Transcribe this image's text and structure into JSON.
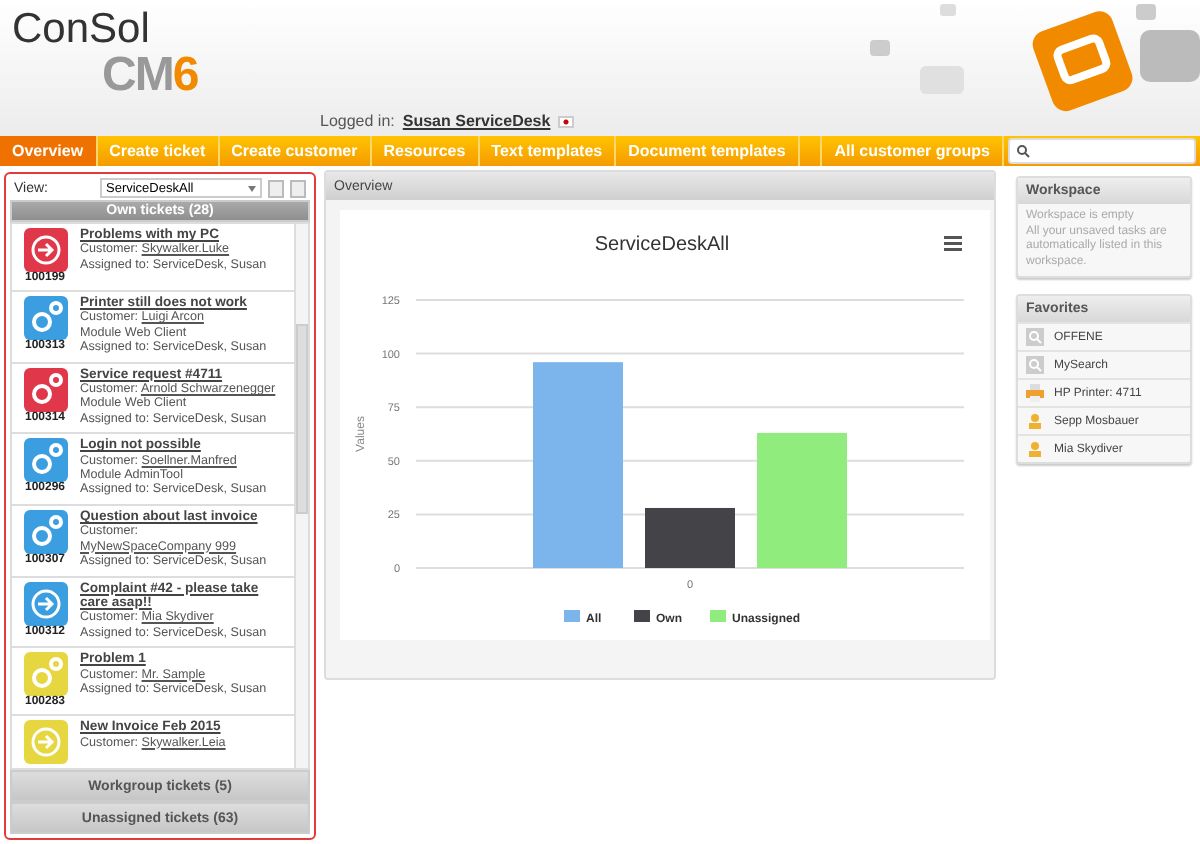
{
  "logo": {
    "line1": "ConSol",
    "line2": "CM",
    "version": "6"
  },
  "login": {
    "label": "Logged in:",
    "user": "Susan ServiceDesk"
  },
  "nav": [
    {
      "label": "Overview",
      "selected": true
    },
    {
      "label": "Create ticket",
      "selected": false
    },
    {
      "label": "Create customer",
      "selected": false
    },
    {
      "label": "Resources",
      "selected": false
    },
    {
      "label": "Text templates",
      "selected": false
    },
    {
      "label": "Document templates",
      "selected": false
    }
  ],
  "nav_right": "All customer groups",
  "view": {
    "label": "View:",
    "value": "ServiceDeskAll"
  },
  "ticket_sections": [
    {
      "title": "Own tickets (28)",
      "expanded": true
    },
    {
      "title": "Workgroup tickets (5)",
      "expanded": false
    },
    {
      "title": "Unassigned tickets (63)",
      "expanded": false
    }
  ],
  "tickets": [
    {
      "kind": "arrow",
      "color": "#e0384a",
      "number": "100199",
      "title": "Problems with my PC",
      "lines": [
        {
          "label": "Customer:",
          "value": "Skywalker.Luke",
          "link": true
        },
        {
          "label": "Assigned to:",
          "value": "ServiceDesk, Susan",
          "link": false
        }
      ]
    },
    {
      "kind": "gear",
      "color": "#3a9ee0",
      "number": "100313",
      "title": "Printer still does not work",
      "lines": [
        {
          "label": "Customer:",
          "value": "Luigi Arcon",
          "link": true
        },
        {
          "label": "Module",
          "value": "Web Client",
          "link": false
        },
        {
          "label": "Assigned to:",
          "value": "ServiceDesk, Susan",
          "link": false
        }
      ]
    },
    {
      "kind": "gear",
      "color": "#e0384a",
      "number": "100314",
      "title": "Service request #4711",
      "lines": [
        {
          "label": "Customer:",
          "value": "Arnold Schwarzenegger",
          "link": true
        },
        {
          "label": "Module",
          "value": "Web Client",
          "link": false
        },
        {
          "label": "Assigned to:",
          "value": "ServiceDesk, Susan",
          "link": false
        }
      ]
    },
    {
      "kind": "gear",
      "color": "#3a9ee0",
      "number": "100296",
      "title": "Login not possible",
      "lines": [
        {
          "label": "Customer:",
          "value": "Soellner.Manfred",
          "link": true
        },
        {
          "label": "Module",
          "value": "AdminTool",
          "link": false
        },
        {
          "label": "Assigned to:",
          "value": "ServiceDesk, Susan",
          "link": false
        }
      ]
    },
    {
      "kind": "gear",
      "color": "#3a9ee0",
      "number": "100307",
      "title": "Question about last invoice",
      "lines": [
        {
          "label": "Customer:",
          "value": "MyNewSpaceCompany 999",
          "link": true
        },
        {
          "label": "Assigned to:",
          "value": "ServiceDesk, Susan",
          "link": false
        }
      ]
    },
    {
      "kind": "arrow",
      "color": "#3a9ee0",
      "number": "100312",
      "title": "Complaint #42 - please take care asap!!",
      "lines": [
        {
          "label": "Customer:",
          "value": "Mia Skydiver",
          "link": true
        },
        {
          "label": "Assigned to:",
          "value": "ServiceDesk, Susan",
          "link": false
        }
      ]
    },
    {
      "kind": "gear",
      "color": "#e6d640",
      "number": "100283",
      "title": "Problem 1",
      "lines": [
        {
          "label": "Customer:",
          "value": "Mr. Sample",
          "link": true
        },
        {
          "label": "Assigned to:",
          "value": "ServiceDesk, Susan",
          "link": false
        }
      ]
    },
    {
      "kind": "arrow",
      "color": "#e6d640",
      "title": "New Invoice Feb 2015",
      "lines": [
        {
          "label": "Customer:",
          "value": "Skywalker.Leia",
          "link": true
        }
      ]
    }
  ],
  "overview": {
    "title": "Overview",
    "chart_data": {
      "type": "bar",
      "title": "ServiceDeskAll",
      "ylabel": "Values",
      "categories": [
        "0"
      ],
      "series": [
        {
          "name": "All",
          "color": "#7cb5ec",
          "values": [
            96
          ]
        },
        {
          "name": "Own",
          "color": "#434348",
          "values": [
            28
          ]
        },
        {
          "name": "Unassigned",
          "color": "#90ed7d",
          "values": [
            63
          ]
        }
      ],
      "ylim": [
        0,
        125
      ],
      "grid": true,
      "legend": true,
      "yticks": [
        0,
        25,
        50,
        75,
        100,
        125
      ]
    }
  },
  "workspace": {
    "title": "Workspace",
    "text": "Workspace is empty\nAll your unsaved tasks are automatically listed in this workspace."
  },
  "favorites": {
    "title": "Favorites",
    "items": [
      {
        "kind": "search",
        "label": "OFFENE"
      },
      {
        "kind": "search",
        "label": "MySearch"
      },
      {
        "kind": "device",
        "label": "HP Printer: 4711"
      },
      {
        "kind": "person",
        "label": "Sepp Mosbauer"
      },
      {
        "kind": "person",
        "label": "Mia Skydiver"
      }
    ]
  }
}
